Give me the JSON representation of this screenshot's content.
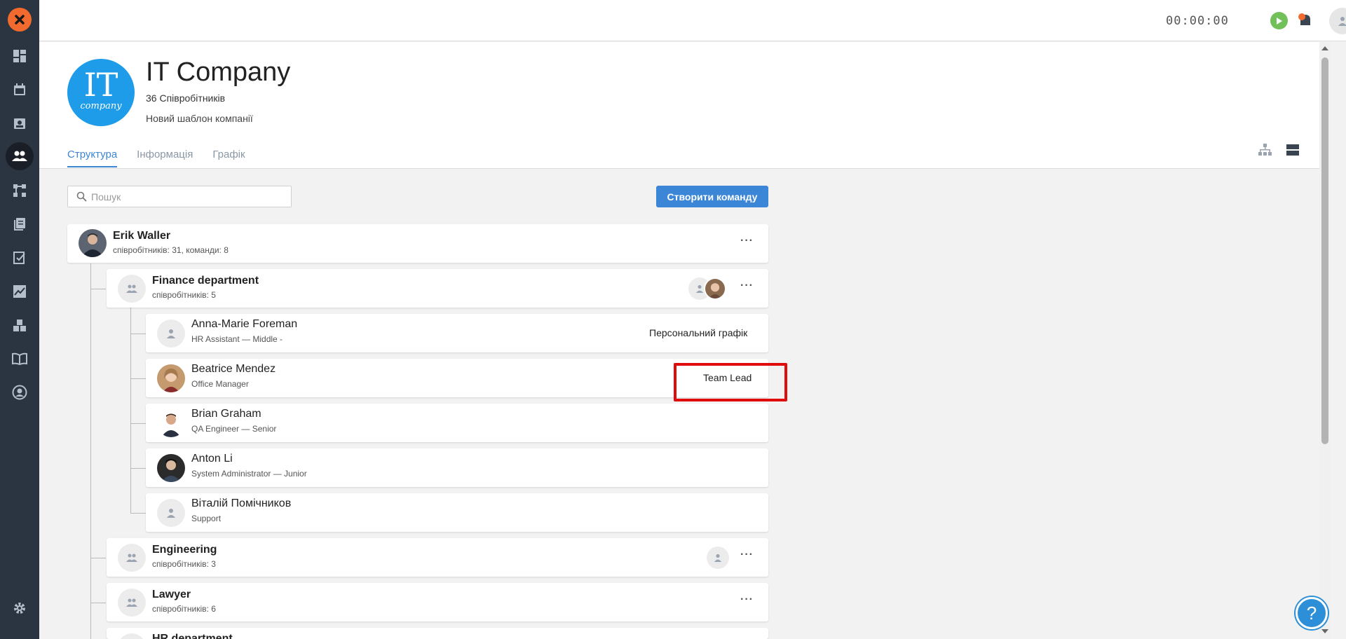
{
  "topbar": {
    "timer": "00:00:00"
  },
  "company": {
    "logo_big": "IT",
    "logo_small": "company",
    "name": "IT Company",
    "employees": "36 Співробітників",
    "description": "Новий шаблон компанії"
  },
  "tabs": [
    {
      "label": "Структура",
      "active": true
    },
    {
      "label": "Інформація",
      "active": false
    },
    {
      "label": "Графік",
      "active": false
    }
  ],
  "search": {
    "placeholder": "Пошук"
  },
  "create_button": "Створити команду",
  "root": {
    "name": "Erik Waller",
    "sub": "співробітників: 31, команди: 8"
  },
  "teams": [
    {
      "name": "Finance department",
      "sub": "співробітників: 5"
    },
    {
      "name": "Engineering",
      "sub": "співробітників: 3"
    },
    {
      "name": "Lawyer",
      "sub": "співробітників: 6"
    },
    {
      "name": "HR department",
      "sub": ""
    }
  ],
  "members": [
    {
      "name": "Anna-Marie Foreman",
      "sub": "HR Assistant — Middle -",
      "tag": "Персональний графік"
    },
    {
      "name": "Beatrice Mendez",
      "sub": "Office Manager",
      "tag": "Team Lead"
    },
    {
      "name": "Brian Graham",
      "sub": "QA Engineer — Senior",
      "tag": ""
    },
    {
      "name": "Anton Li",
      "sub": "System Administrator — Junior",
      "tag": ""
    },
    {
      "name": "Віталій Помічников",
      "sub": "Support",
      "tag": ""
    }
  ],
  "icons": {
    "rail": [
      "dashboard-icon",
      "calendar-icon",
      "contact-icon",
      "people-icon",
      "workflow-icon",
      "documents-icon",
      "tasks-icon",
      "analytics-icon",
      "inventory-icon",
      "knowledge-icon",
      "profile-icon",
      "settings-icon"
    ]
  },
  "colors": {
    "accent": "#3b86d6",
    "rail": "#2b3441",
    "logo": "#f26a2e",
    "highlight": "#e00b0b"
  }
}
